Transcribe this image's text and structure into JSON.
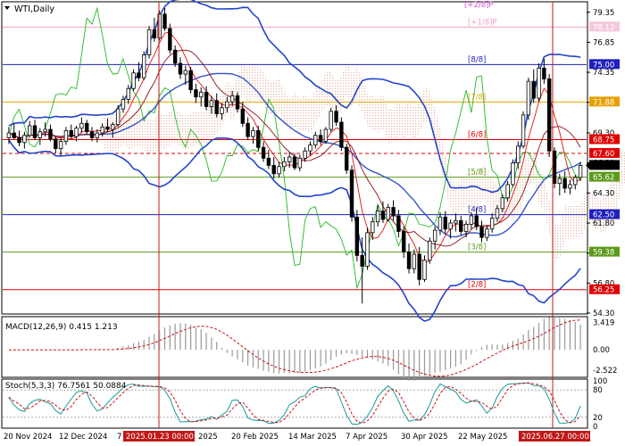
{
  "chart_data": {
    "type": "candlestick",
    "symbol": "WTI,Daily",
    "price_axis": {
      "min": 54.3,
      "max": 80.15,
      "ticks": [
        79.35,
        76.85,
        74.35,
        71.85,
        69.3,
        66.8,
        64.3,
        61.8,
        59.3,
        56.8,
        54.3
      ],
      "hidden_ticks": [
        78.1,
        65.6,
        63.0,
        58.0
      ]
    },
    "x_axis": {
      "labels": [
        "20 Nov 2024",
        "12 Dec 2024",
        "7 Jan 2025",
        "2025",
        "20 Feb 2025",
        "14 Mar 2025",
        "7 Apr 2025",
        "30 Apr 2025",
        "22 May 2025"
      ],
      "highlight_labels": [
        "2025.01.23 00:00",
        "2025.06.27 00:00"
      ]
    },
    "murrey_levels": [
      {
        "label": "[+2/8]P",
        "value": 80.6,
        "color": "#d44fd4"
      },
      {
        "label": "[+1/8]P",
        "value": 78.12,
        "color": "#f0a0c8"
      },
      {
        "label": "[8/8]",
        "value": 75.0,
        "color": "#1f1fbf"
      },
      {
        "label": "[7/8]",
        "value": 71.88,
        "color": "#e8a000"
      },
      {
        "label": "[6/8]",
        "value": 68.75,
        "color": "#e00000"
      },
      {
        "label": "[5/8]",
        "value": 65.62,
        "color": "#5c9a1a"
      },
      {
        "label": "[4/8]",
        "value": 62.5,
        "color": "#1f1fbf"
      },
      {
        "label": "[3/8]",
        "value": 59.38,
        "color": "#5c9a1a"
      },
      {
        "label": "[2/8]",
        "value": 56.25,
        "color": "#e00000"
      }
    ],
    "price_badges": [
      {
        "text": "75.00",
        "value": 75.0,
        "color": "#1f1fbf"
      },
      {
        "text": "71.88",
        "value": 71.88,
        "color": "#e8a000"
      },
      {
        "text": "68.75",
        "value": 68.75,
        "color": "#e00000"
      },
      {
        "text": "67.60",
        "value": 67.6,
        "color": "#e00000"
      },
      {
        "text": "65.62",
        "value": 65.62,
        "color": "#5c9a1a"
      },
      {
        "text": "62.50",
        "value": 62.5,
        "color": "#1f1fbf"
      },
      {
        "text": "59.38",
        "value": 59.38,
        "color": "#5c9a1a"
      },
      {
        "text": "56.25",
        "value": 56.25,
        "color": "#e00000"
      },
      {
        "text": "78.12",
        "value": 78.12,
        "color": "#f5c8dd"
      }
    ],
    "dashed_level": {
      "value": 67.6,
      "color": "#e00000"
    },
    "candles": [
      [
        68.9,
        69.8,
        68.4,
        69.3
      ],
      [
        69.3,
        70.1,
        68.8,
        68.9
      ],
      [
        68.9,
        69.5,
        68.2,
        68.5
      ],
      [
        68.5,
        69.4,
        68.0,
        69.1
      ],
      [
        69.1,
        70.3,
        68.9,
        69.9
      ],
      [
        69.9,
        70.4,
        68.7,
        68.9
      ],
      [
        68.9,
        69.7,
        68.3,
        69.4
      ],
      [
        69.4,
        70.2,
        69.0,
        69.6
      ],
      [
        69.6,
        70.0,
        68.6,
        68.8
      ],
      [
        68.8,
        69.0,
        67.6,
        68.0
      ],
      [
        68.0,
        68.9,
        67.4,
        68.6
      ],
      [
        68.6,
        69.8,
        68.3,
        69.5
      ],
      [
        69.5,
        70.0,
        68.8,
        69.0
      ],
      [
        69.0,
        69.9,
        68.6,
        69.7
      ],
      [
        69.7,
        70.6,
        69.3,
        70.1
      ],
      [
        70.1,
        70.4,
        69.2,
        69.4
      ],
      [
        69.4,
        69.8,
        68.6,
        68.9
      ],
      [
        68.9,
        69.6,
        68.5,
        69.3
      ],
      [
        69.3,
        70.1,
        69.0,
        69.8
      ],
      [
        69.8,
        70.5,
        69.4,
        69.6
      ],
      [
        69.6,
        70.2,
        68.9,
        70.0
      ],
      [
        70.0,
        71.6,
        69.8,
        71.3
      ],
      [
        71.3,
        72.4,
        71.0,
        72.1
      ],
      [
        72.1,
        73.3,
        71.7,
        73.0
      ],
      [
        73.0,
        74.6,
        72.8,
        74.3
      ],
      [
        74.3,
        75.2,
        73.6,
        73.9
      ],
      [
        73.9,
        76.1,
        73.7,
        75.8
      ],
      [
        75.8,
        78.2,
        75.5,
        77.9
      ],
      [
        77.9,
        78.9,
        76.9,
        77.2
      ],
      [
        77.2,
        79.5,
        77.0,
        79.2
      ],
      [
        79.2,
        79.7,
        77.8,
        78.0
      ],
      [
        78.0,
        78.4,
        75.9,
        76.2
      ],
      [
        76.2,
        76.6,
        74.8,
        75.1
      ],
      [
        75.1,
        75.6,
        73.8,
        74.2
      ],
      [
        74.2,
        74.9,
        73.3,
        74.5
      ],
      [
        74.5,
        74.8,
        72.6,
        72.9
      ],
      [
        72.9,
        73.4,
        71.8,
        72.3
      ],
      [
        72.3,
        73.1,
        71.5,
        72.7
      ],
      [
        72.7,
        73.2,
        71.2,
        71.5
      ],
      [
        71.5,
        72.4,
        70.9,
        72.0
      ],
      [
        72.0,
        72.6,
        70.6,
        70.9
      ],
      [
        70.9,
        71.8,
        70.4,
        71.4
      ],
      [
        71.4,
        72.3,
        71.0,
        71.9
      ],
      [
        71.9,
        72.8,
        71.5,
        72.4
      ],
      [
        72.4,
        72.7,
        71.0,
        71.3
      ],
      [
        71.3,
        71.9,
        69.8,
        70.1
      ],
      [
        70.1,
        70.6,
        68.7,
        69.0
      ],
      [
        69.0,
        69.8,
        68.4,
        69.5
      ],
      [
        69.5,
        69.9,
        67.8,
        68.1
      ],
      [
        68.1,
        68.6,
        66.9,
        67.2
      ],
      [
        67.2,
        67.9,
        66.3,
        66.6
      ],
      [
        66.6,
        67.3,
        65.5,
        65.9
      ],
      [
        65.9,
        66.9,
        65.6,
        66.5
      ],
      [
        66.5,
        67.3,
        66.1,
        66.9
      ],
      [
        66.9,
        67.7,
        66.4,
        67.3
      ],
      [
        67.3,
        67.6,
        66.2,
        66.4
      ],
      [
        66.4,
        67.5,
        66.1,
        67.2
      ],
      [
        67.2,
        68.1,
        66.9,
        67.8
      ],
      [
        67.8,
        68.6,
        67.4,
        68.3
      ],
      [
        68.3,
        69.4,
        68.0,
        69.1
      ],
      [
        69.1,
        69.6,
        68.3,
        68.6
      ],
      [
        68.6,
        69.8,
        68.4,
        69.6
      ],
      [
        69.6,
        71.4,
        69.4,
        71.1
      ],
      [
        71.1,
        71.6,
        69.9,
        70.2
      ],
      [
        70.2,
        70.6,
        67.8,
        68.1
      ],
      [
        68.1,
        68.4,
        65.9,
        66.2
      ],
      [
        66.2,
        66.6,
        61.9,
        62.3
      ],
      [
        62.3,
        62.9,
        58.6,
        59.1
      ],
      [
        59.1,
        60.6,
        55.1,
        58.2
      ],
      [
        58.2,
        61.4,
        57.9,
        61.0
      ],
      [
        61.0,
        62.3,
        60.4,
        61.9
      ],
      [
        61.9,
        63.3,
        61.5,
        62.8
      ],
      [
        62.8,
        63.6,
        61.8,
        62.1
      ],
      [
        62.1,
        63.4,
        61.9,
        63.1
      ],
      [
        63.1,
        63.7,
        62.0,
        62.4
      ],
      [
        62.4,
        62.9,
        60.6,
        61.1
      ],
      [
        61.1,
        61.5,
        58.9,
        59.4
      ],
      [
        59.4,
        60.1,
        57.6,
        58.0
      ],
      [
        58.0,
        59.6,
        57.6,
        59.2
      ],
      [
        59.2,
        59.8,
        56.6,
        57.1
      ],
      [
        57.1,
        59.1,
        56.9,
        58.7
      ],
      [
        58.7,
        60.6,
        58.4,
        60.3
      ],
      [
        60.3,
        61.5,
        59.6,
        61.2
      ],
      [
        61.2,
        62.7,
        60.8,
        62.3
      ],
      [
        62.3,
        62.8,
        60.9,
        61.3
      ],
      [
        61.3,
        62.1,
        60.5,
        61.8
      ],
      [
        61.8,
        62.6,
        61.1,
        62.0
      ],
      [
        62.0,
        62.4,
        60.8,
        61.1
      ],
      [
        61.1,
        62.0,
        60.6,
        61.7
      ],
      [
        61.7,
        62.7,
        61.3,
        62.4
      ],
      [
        62.4,
        63.1,
        61.2,
        61.5
      ],
      [
        61.5,
        62.0,
        60.2,
        60.6
      ],
      [
        60.6,
        61.6,
        60.3,
        61.3
      ],
      [
        61.3,
        62.6,
        61.0,
        62.2
      ],
      [
        62.2,
        63.3,
        61.9,
        63.0
      ],
      [
        63.0,
        64.2,
        62.7,
        63.9
      ],
      [
        63.9,
        65.3,
        63.6,
        65.0
      ],
      [
        65.0,
        67.1,
        64.8,
        66.8
      ],
      [
        66.8,
        68.6,
        66.3,
        68.2
      ],
      [
        68.2,
        71.1,
        68.0,
        70.8
      ],
      [
        70.8,
        73.9,
        70.4,
        73.6
      ],
      [
        73.6,
        74.6,
        71.8,
        72.2
      ],
      [
        72.2,
        75.1,
        71.9,
        74.7
      ],
      [
        74.7,
        75.5,
        73.4,
        73.8
      ],
      [
        73.8,
        74.2,
        67.3,
        67.8
      ],
      [
        67.8,
        68.1,
        64.7,
        65.1
      ],
      [
        65.1,
        65.9,
        64.1,
        65.5
      ],
      [
        65.5,
        66.1,
        64.3,
        64.7
      ],
      [
        64.7,
        65.4,
        64.2,
        65.0
      ],
      [
        65.0,
        65.8,
        64.6,
        65.6
      ],
      [
        65.6,
        66.9,
        65.3,
        66.6
      ]
    ],
    "indicators": {
      "macd": {
        "label": "MACD(12,26,9) 0.415 1.213",
        "ylim": [
          -3.2,
          3.9
        ],
        "ticks": [
          3.419,
          0.0,
          -2.522
        ]
      },
      "stoch": {
        "label": "Stoch(5,3,3) 76.7561 50.0884",
        "ylim": [
          0,
          100
        ],
        "ticks": [
          100,
          80,
          20,
          0
        ]
      }
    }
  }
}
